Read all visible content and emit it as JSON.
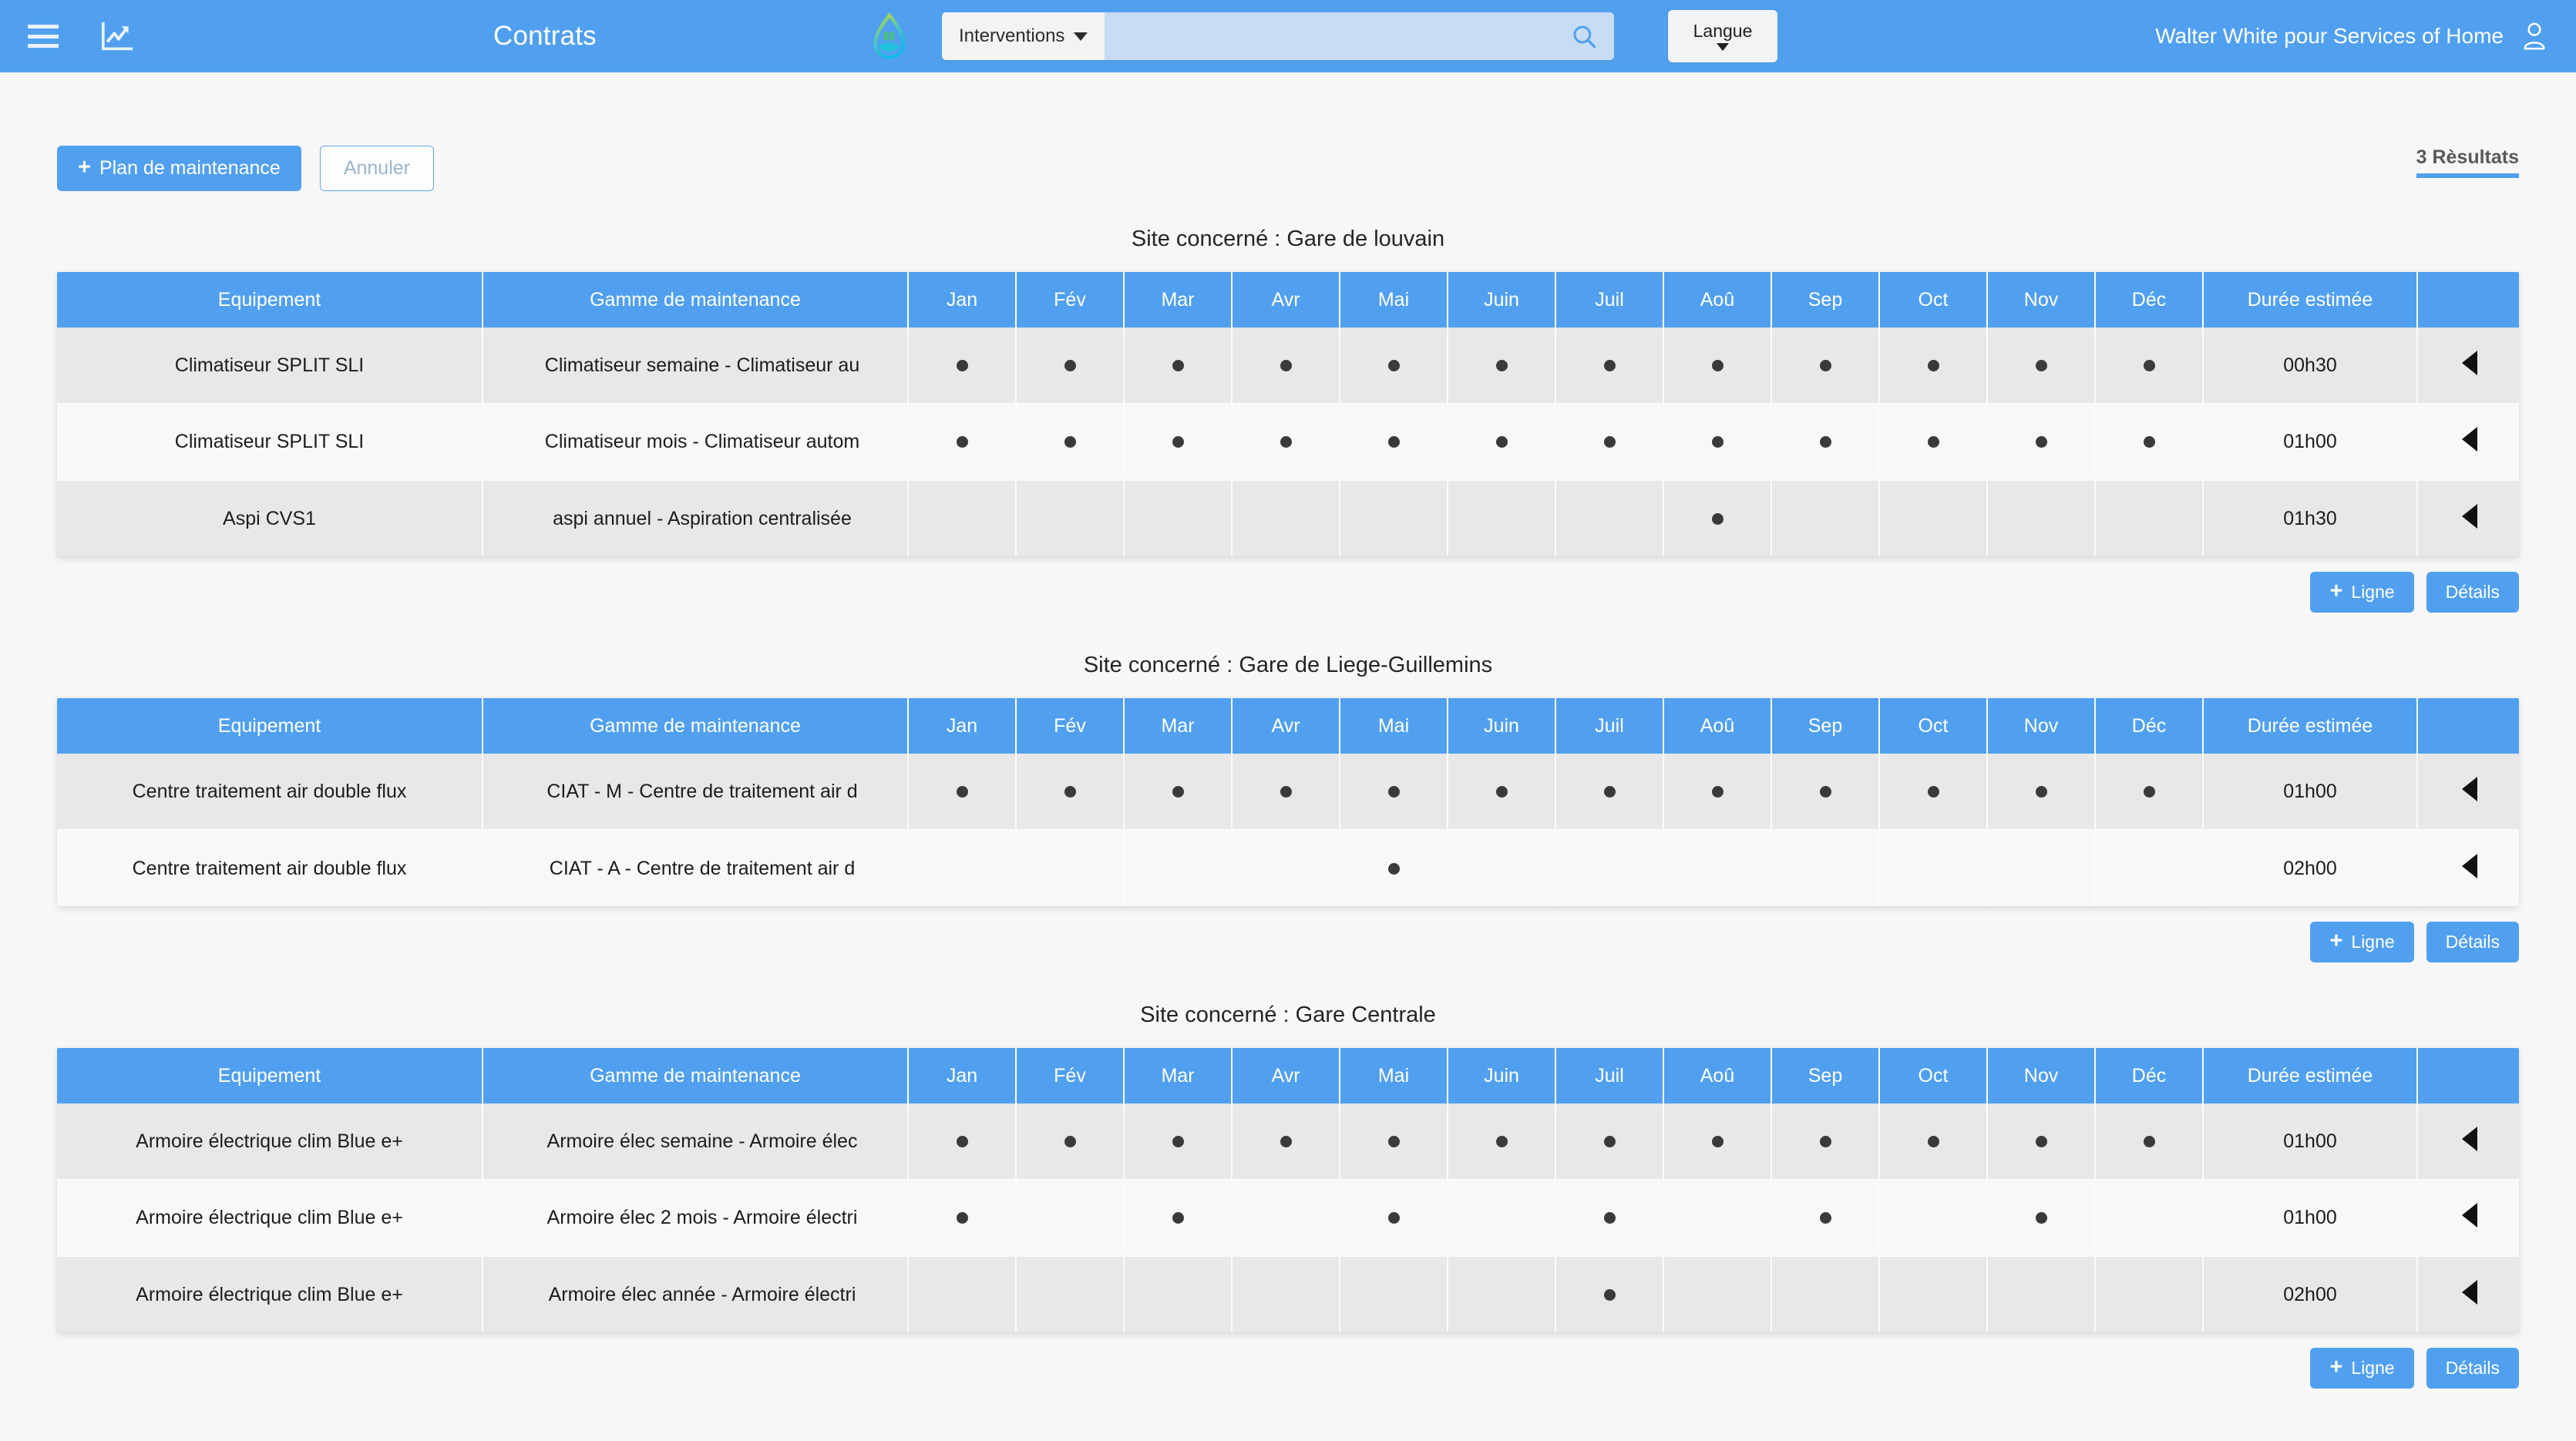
{
  "topbar": {
    "menu_icon": "hamburger-icon",
    "chart_icon": "chart-line-icon",
    "title": "Contrats",
    "logo_icon": "home-leaf-logo",
    "search": {
      "category": "Interventions",
      "value": "",
      "placeholder": "",
      "search_icon": "search-icon"
    },
    "language_button": "Langue",
    "user_label": "Walter White pour Services of Home",
    "user_icon": "user-icon"
  },
  "toolbar": {
    "add_plan_label": "Plan de maintenance",
    "cancel_label": "Annuler",
    "results_label": "3 Rèsultats"
  },
  "table_footer": {
    "add_line_label": "Ligne",
    "details_label": "Détails"
  },
  "columns": {
    "equipment": "Equipement",
    "gamme": "Gamme de maintenance",
    "duration": "Durée estimée",
    "action": ""
  },
  "months": [
    "Jan",
    "Fév",
    "Mar",
    "Avr",
    "Mai",
    "Juin",
    "Juil",
    "Aoû",
    "Sep",
    "Oct",
    "Nov",
    "Déc"
  ],
  "colors": {
    "accent": "#51a0ef",
    "page_bg": "#f7f7f8",
    "row_odd": "#e8e8e8",
    "row_even": "#f8f8f8",
    "dot": "#3a3a3a"
  },
  "blocks": [
    {
      "site_title": "Site concerné : Gare de louvain",
      "rows": [
        {
          "equipment": "Climatiseur SPLIT SLI",
          "gamme": "Climatiseur semaine - Climatiseur au",
          "months": [
            true,
            true,
            true,
            true,
            true,
            true,
            true,
            true,
            true,
            true,
            true,
            true
          ],
          "duration": "00h30",
          "action_icon": "expand-left-triangle-icon"
        },
        {
          "equipment": "Climatiseur SPLIT SLI",
          "gamme": "Climatiseur mois - Climatiseur autom",
          "months": [
            true,
            true,
            true,
            true,
            true,
            true,
            true,
            true,
            true,
            true,
            true,
            true
          ],
          "duration": "01h00",
          "action_icon": "expand-left-triangle-icon"
        },
        {
          "equipment": "Aspi CVS1",
          "gamme": "aspi annuel - Aspiration centralisée",
          "months": [
            false,
            false,
            false,
            false,
            false,
            false,
            false,
            true,
            false,
            false,
            false,
            false
          ],
          "duration": "01h30",
          "action_icon": "expand-left-triangle-icon"
        }
      ]
    },
    {
      "site_title": "Site concerné : Gare de Liege-Guillemins",
      "rows": [
        {
          "equipment": "Centre traitement air double flux",
          "gamme": "CIAT - M - Centre de traitement air d",
          "months": [
            true,
            true,
            true,
            true,
            true,
            true,
            true,
            true,
            true,
            true,
            true,
            true
          ],
          "duration": "01h00",
          "action_icon": "expand-left-triangle-icon"
        },
        {
          "equipment": "Centre traitement air double flux",
          "gamme": "CIAT - A - Centre de traitement air d",
          "months": [
            false,
            false,
            false,
            false,
            true,
            false,
            false,
            false,
            false,
            false,
            false,
            false
          ],
          "duration": "02h00",
          "action_icon": "expand-left-triangle-icon"
        }
      ]
    },
    {
      "site_title": "Site concerné : Gare Centrale",
      "rows": [
        {
          "equipment": "Armoire électrique clim Blue e+",
          "gamme": "Armoire élec semaine - Armoire élec",
          "months": [
            true,
            true,
            true,
            true,
            true,
            true,
            true,
            true,
            true,
            true,
            true,
            true
          ],
          "duration": "01h00",
          "action_icon": "expand-left-triangle-icon"
        },
        {
          "equipment": "Armoire électrique clim Blue e+",
          "gamme": "Armoire élec 2 mois - Armoire électri",
          "months": [
            true,
            false,
            true,
            false,
            true,
            false,
            true,
            false,
            true,
            false,
            true,
            false
          ],
          "duration": "01h00",
          "action_icon": "expand-left-triangle-icon"
        },
        {
          "equipment": "Armoire électrique clim Blue e+",
          "gamme": "Armoire élec année - Armoire électri",
          "months": [
            false,
            false,
            false,
            false,
            false,
            false,
            true,
            false,
            false,
            false,
            false,
            false
          ],
          "duration": "02h00",
          "action_icon": "expand-left-triangle-icon"
        }
      ]
    }
  ]
}
